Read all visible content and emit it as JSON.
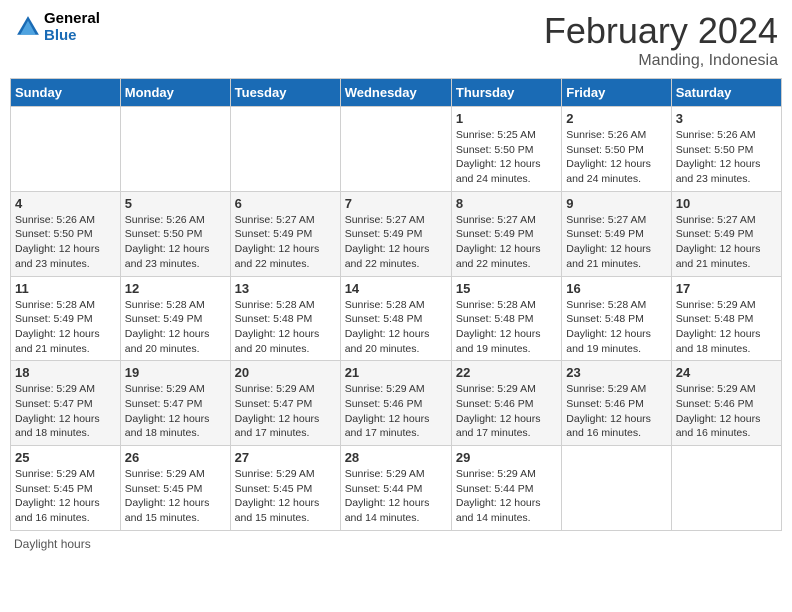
{
  "header": {
    "logo_line1": "General",
    "logo_line2": "Blue",
    "title": "February 2024",
    "subtitle": "Manding, Indonesia"
  },
  "days_of_week": [
    "Sunday",
    "Monday",
    "Tuesday",
    "Wednesday",
    "Thursday",
    "Friday",
    "Saturday"
  ],
  "weeks": [
    [
      {
        "day": "",
        "detail": ""
      },
      {
        "day": "",
        "detail": ""
      },
      {
        "day": "",
        "detail": ""
      },
      {
        "day": "",
        "detail": ""
      },
      {
        "day": "1",
        "detail": "Sunrise: 5:25 AM\nSunset: 5:50 PM\nDaylight: 12 hours and 24 minutes."
      },
      {
        "day": "2",
        "detail": "Sunrise: 5:26 AM\nSunset: 5:50 PM\nDaylight: 12 hours and 24 minutes."
      },
      {
        "day": "3",
        "detail": "Sunrise: 5:26 AM\nSunset: 5:50 PM\nDaylight: 12 hours and 23 minutes."
      }
    ],
    [
      {
        "day": "4",
        "detail": "Sunrise: 5:26 AM\nSunset: 5:50 PM\nDaylight: 12 hours and 23 minutes."
      },
      {
        "day": "5",
        "detail": "Sunrise: 5:26 AM\nSunset: 5:50 PM\nDaylight: 12 hours and 23 minutes."
      },
      {
        "day": "6",
        "detail": "Sunrise: 5:27 AM\nSunset: 5:49 PM\nDaylight: 12 hours and 22 minutes."
      },
      {
        "day": "7",
        "detail": "Sunrise: 5:27 AM\nSunset: 5:49 PM\nDaylight: 12 hours and 22 minutes."
      },
      {
        "day": "8",
        "detail": "Sunrise: 5:27 AM\nSunset: 5:49 PM\nDaylight: 12 hours and 22 minutes."
      },
      {
        "day": "9",
        "detail": "Sunrise: 5:27 AM\nSunset: 5:49 PM\nDaylight: 12 hours and 21 minutes."
      },
      {
        "day": "10",
        "detail": "Sunrise: 5:27 AM\nSunset: 5:49 PM\nDaylight: 12 hours and 21 minutes."
      }
    ],
    [
      {
        "day": "11",
        "detail": "Sunrise: 5:28 AM\nSunset: 5:49 PM\nDaylight: 12 hours and 21 minutes."
      },
      {
        "day": "12",
        "detail": "Sunrise: 5:28 AM\nSunset: 5:49 PM\nDaylight: 12 hours and 20 minutes."
      },
      {
        "day": "13",
        "detail": "Sunrise: 5:28 AM\nSunset: 5:48 PM\nDaylight: 12 hours and 20 minutes."
      },
      {
        "day": "14",
        "detail": "Sunrise: 5:28 AM\nSunset: 5:48 PM\nDaylight: 12 hours and 20 minutes."
      },
      {
        "day": "15",
        "detail": "Sunrise: 5:28 AM\nSunset: 5:48 PM\nDaylight: 12 hours and 19 minutes."
      },
      {
        "day": "16",
        "detail": "Sunrise: 5:28 AM\nSunset: 5:48 PM\nDaylight: 12 hours and 19 minutes."
      },
      {
        "day": "17",
        "detail": "Sunrise: 5:29 AM\nSunset: 5:48 PM\nDaylight: 12 hours and 18 minutes."
      }
    ],
    [
      {
        "day": "18",
        "detail": "Sunrise: 5:29 AM\nSunset: 5:47 PM\nDaylight: 12 hours and 18 minutes."
      },
      {
        "day": "19",
        "detail": "Sunrise: 5:29 AM\nSunset: 5:47 PM\nDaylight: 12 hours and 18 minutes."
      },
      {
        "day": "20",
        "detail": "Sunrise: 5:29 AM\nSunset: 5:47 PM\nDaylight: 12 hours and 17 minutes."
      },
      {
        "day": "21",
        "detail": "Sunrise: 5:29 AM\nSunset: 5:46 PM\nDaylight: 12 hours and 17 minutes."
      },
      {
        "day": "22",
        "detail": "Sunrise: 5:29 AM\nSunset: 5:46 PM\nDaylight: 12 hours and 17 minutes."
      },
      {
        "day": "23",
        "detail": "Sunrise: 5:29 AM\nSunset: 5:46 PM\nDaylight: 12 hours and 16 minutes."
      },
      {
        "day": "24",
        "detail": "Sunrise: 5:29 AM\nSunset: 5:46 PM\nDaylight: 12 hours and 16 minutes."
      }
    ],
    [
      {
        "day": "25",
        "detail": "Sunrise: 5:29 AM\nSunset: 5:45 PM\nDaylight: 12 hours and 16 minutes."
      },
      {
        "day": "26",
        "detail": "Sunrise: 5:29 AM\nSunset: 5:45 PM\nDaylight: 12 hours and 15 minutes."
      },
      {
        "day": "27",
        "detail": "Sunrise: 5:29 AM\nSunset: 5:45 PM\nDaylight: 12 hours and 15 minutes."
      },
      {
        "day": "28",
        "detail": "Sunrise: 5:29 AM\nSunset: 5:44 PM\nDaylight: 12 hours and 14 minutes."
      },
      {
        "day": "29",
        "detail": "Sunrise: 5:29 AM\nSunset: 5:44 PM\nDaylight: 12 hours and 14 minutes."
      },
      {
        "day": "",
        "detail": ""
      },
      {
        "day": "",
        "detail": ""
      }
    ]
  ],
  "footer": "Daylight hours"
}
